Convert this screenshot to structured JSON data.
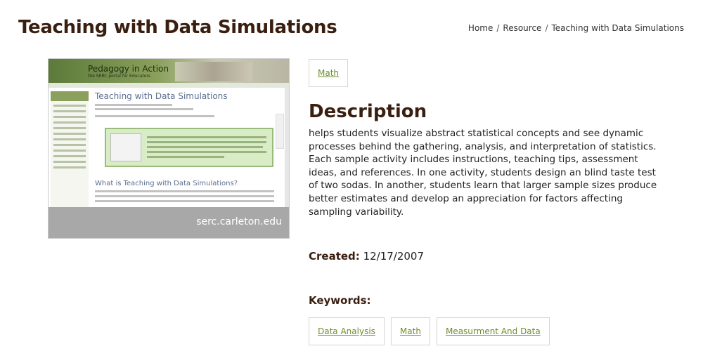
{
  "page": {
    "title": "Teaching with Data Simulations"
  },
  "breadcrumb": [
    {
      "label": "Home"
    },
    {
      "label": "Resource"
    },
    {
      "label": "Teaching with Data Simulations"
    }
  ],
  "breadcrumb_separator": "/",
  "thumbnail": {
    "caption": "serc.carleton.edu",
    "banner_title": "Pedagogy in Action",
    "banner_subtitle": "the SERC portal for Educators",
    "heading": "Teaching with Data Simulations",
    "subheading": "What is Teaching with Data Simulations?"
  },
  "subject_tag": "Math",
  "description": {
    "heading": "Description",
    "body": "helps students visualize abstract statistical concepts and see dynamic processes behind the gathering, analysis, and interpretation of statistics. Each sample activity includes instructions, teaching tips, assessment ideas, and references. In one activity, students design an blind taste test of two sodas. In another, students learn that larger sample sizes produce better estimates and develop an appreciation for factors affecting sampling variability."
  },
  "created": {
    "label": "Created:",
    "value": "12/17/2007"
  },
  "keywords": {
    "label": "Keywords:",
    "items": [
      "Data Analysis",
      "Math",
      "Measurment And Data"
    ]
  },
  "colors": {
    "heading": "#3a1f10",
    "tag_text": "#6b8e2c",
    "tag_border": "#d6d6d6"
  }
}
